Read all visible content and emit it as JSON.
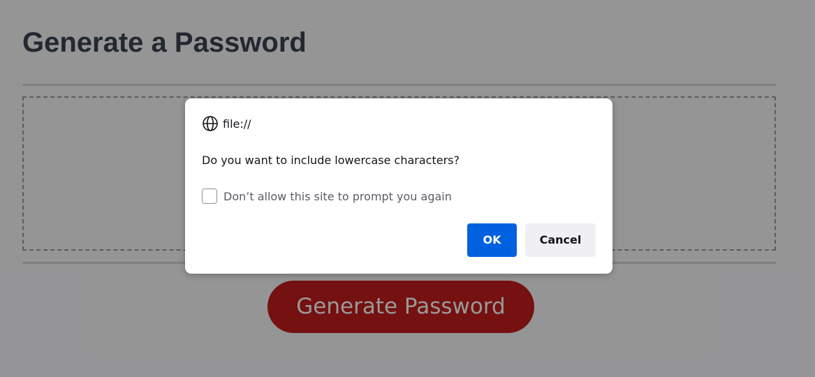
{
  "page": {
    "title": "Generate a Password",
    "generate_button_label": "Generate Password",
    "generate_button_color": "#c31d1d"
  },
  "dialog": {
    "origin": "file://",
    "origin_icon": "globe-icon",
    "message": "Do you want to include lowercase characters?",
    "suppress_checkbox_label": "Don’t allow this site to prompt you again",
    "suppress_checkbox_checked": false,
    "ok_label": "OK",
    "cancel_label": "Cancel",
    "ok_color": "#0061e0"
  }
}
